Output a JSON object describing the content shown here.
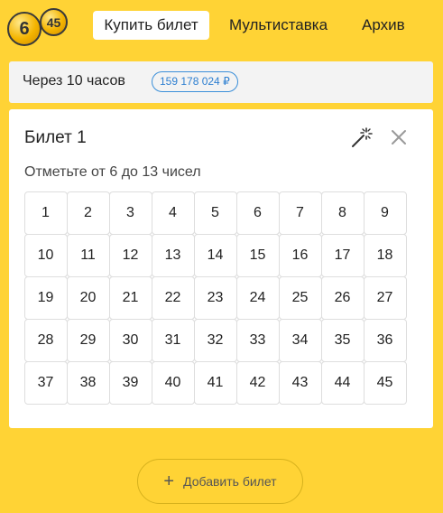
{
  "logo": {
    "ball1": "6",
    "ball2": "45"
  },
  "nav": {
    "buy": "Купить билет",
    "multi": "Мультиставка",
    "archive": "Архив"
  },
  "draw": {
    "time": "Через 10 часов",
    "jackpot": "159 178 024 ₽"
  },
  "ticket": {
    "title": "Билет 1",
    "hint": "Отметьте от 6 до 13 чисел",
    "numbers": [
      "1",
      "2",
      "3",
      "4",
      "5",
      "6",
      "7",
      "8",
      "9",
      "10",
      "11",
      "12",
      "13",
      "14",
      "15",
      "16",
      "17",
      "18",
      "19",
      "20",
      "21",
      "22",
      "23",
      "24",
      "25",
      "26",
      "27",
      "28",
      "29",
      "30",
      "31",
      "32",
      "33",
      "34",
      "35",
      "36",
      "37",
      "38",
      "39",
      "40",
      "41",
      "42",
      "43",
      "44",
      "45"
    ]
  },
  "add_ticket": {
    "icon": "+",
    "label": "Добавить билет"
  },
  "colors": {
    "background": "#ffd335",
    "accent_blue": "#2d7fd1",
    "card": "#ffffff"
  },
  "icons": {
    "wand": "magic-wand-icon",
    "close": "close-icon",
    "plus": "plus-icon"
  }
}
